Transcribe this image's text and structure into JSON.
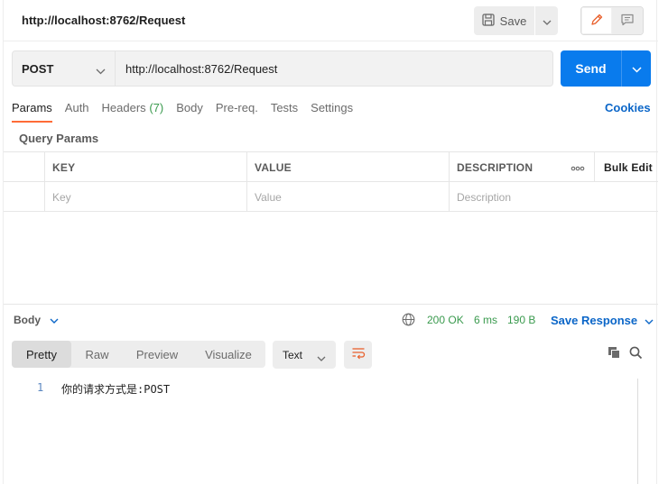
{
  "request": {
    "title": "http://localhost:8762/Request",
    "save_label": "Save",
    "method": "POST",
    "url": "http://localhost:8762/Request",
    "send_label": "Send"
  },
  "tabs": [
    {
      "label": "Params",
      "active": true
    },
    {
      "label": "Auth"
    },
    {
      "label": "Headers",
      "count": "(7)"
    },
    {
      "label": "Body"
    },
    {
      "label": "Pre-req."
    },
    {
      "label": "Tests"
    },
    {
      "label": "Settings"
    }
  ],
  "cookies_label": "Cookies",
  "query_params": {
    "section_label": "Query Params",
    "headers": [
      "KEY",
      "VALUE",
      "DESCRIPTION"
    ],
    "bulk_edit_label": "Bulk Edit",
    "placeholders": [
      "Key",
      "Value",
      "Description"
    ]
  },
  "response": {
    "body_label": "Body",
    "status": "200 OK",
    "time": "6 ms",
    "size": "190 B",
    "save_response_label": "Save Response",
    "view_tabs": [
      "Pretty",
      "Raw",
      "Preview",
      "Visualize"
    ],
    "format": "Text",
    "lines": [
      {
        "num": "1",
        "text": "你的请求方式是:POST"
      }
    ]
  },
  "colors": {
    "accent": "#097bed",
    "status_green": "#3a9a4e",
    "link_blue": "#0b66c8",
    "tab_underline": "#ff6c37"
  }
}
